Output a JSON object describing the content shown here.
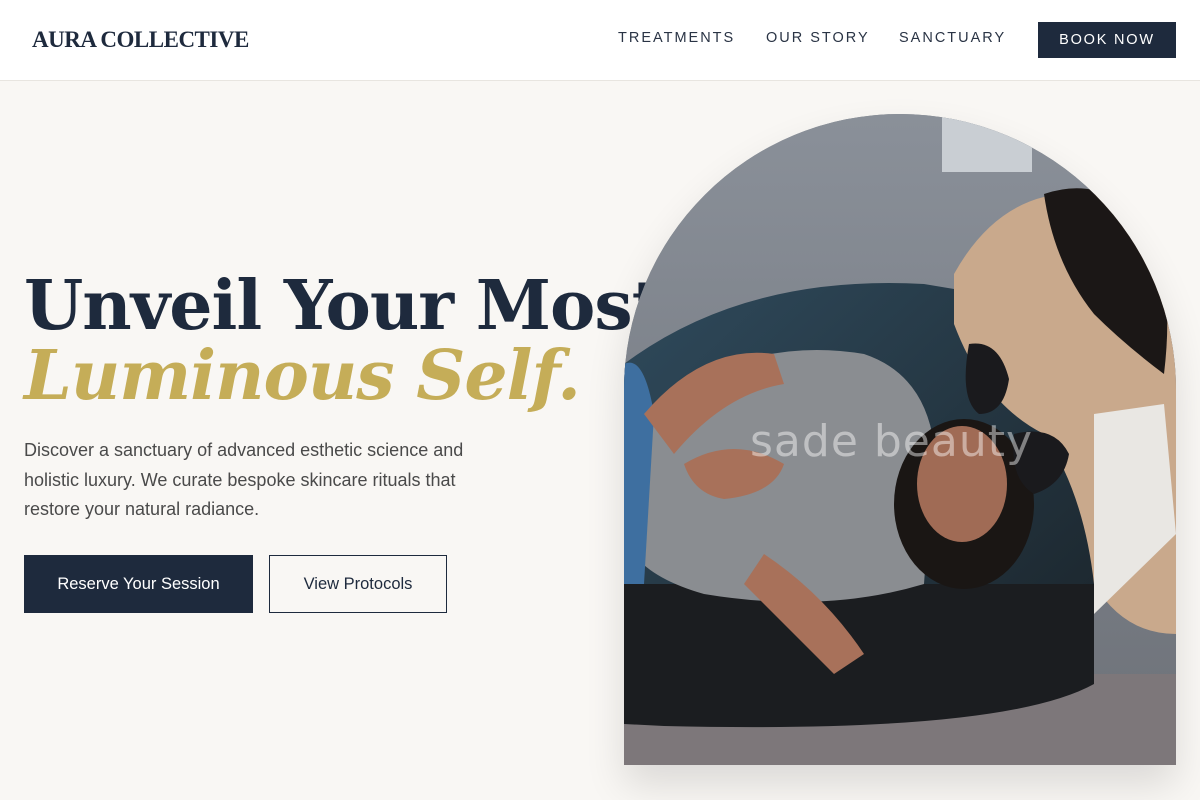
{
  "header": {
    "logo": "AURA COLLECTIVE",
    "nav": [
      "TREATMENTS",
      "OUR STORY",
      "SANCTUARY"
    ],
    "cta": "BOOK NOW"
  },
  "hero": {
    "headline_line1": "Unveil Your Most",
    "headline_line2": "Luminous Self.",
    "description": "Discover a sanctuary of advanced esthetic science and holistic luxury. We curate bespoke skincare rituals that restore your natural radiance.",
    "primary_button": "Reserve Your Session",
    "secondary_button": "View Protocols"
  },
  "image": {
    "watermark": "sade beauty"
  },
  "colors": {
    "navy": "#1e2a3d",
    "gold": "#c5ad58",
    "background": "#f9f7f4"
  }
}
